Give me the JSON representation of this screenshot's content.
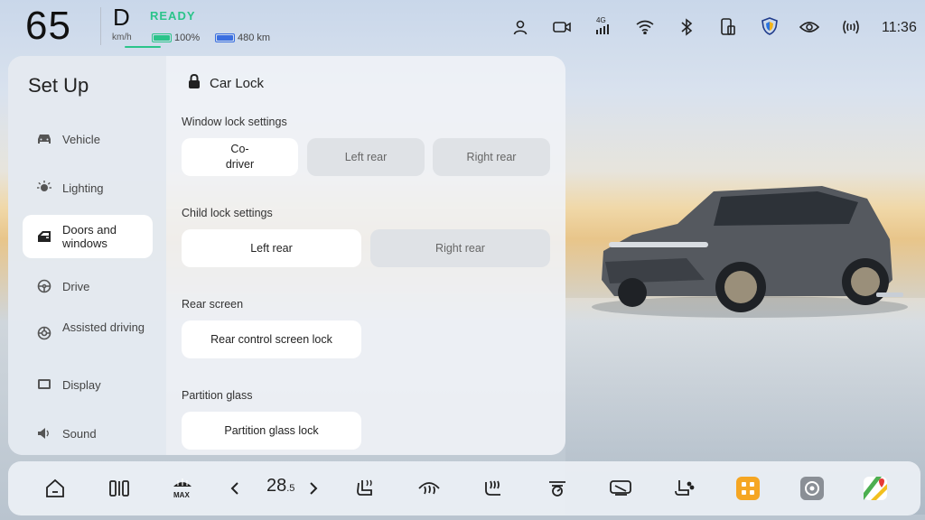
{
  "status_bar": {
    "speed": "65",
    "speed_unit": "km/h",
    "gear": "D",
    "ready": "READY",
    "battery_percent": "100%",
    "range": "480 km",
    "time": "11:36",
    "icons": [
      "person-icon",
      "camera-icon",
      "signal-4g-icon",
      "wifi-icon",
      "bluetooth-icon",
      "phone-device-icon",
      "shield-icon",
      "eye-icon",
      "broadcast-icon"
    ]
  },
  "sidebar": {
    "title": "Set Up",
    "items": [
      {
        "label": "Vehicle",
        "icon": "car-icon"
      },
      {
        "label": "Lighting",
        "icon": "light-icon"
      },
      {
        "label": "Doors and windows",
        "icon": "door-icon",
        "active": true
      },
      {
        "label": "Drive",
        "icon": "steering-icon"
      },
      {
        "label": "Assisted driving",
        "icon": "assist-icon"
      },
      {
        "label": "Display",
        "icon": "display-icon"
      },
      {
        "label": "Sound",
        "icon": "speaker-icon"
      }
    ]
  },
  "content": {
    "title": "Car Lock",
    "window_lock": {
      "label": "Window lock settings",
      "options": [
        "Co-driver",
        "Left rear",
        "Right rear"
      ],
      "selected": [
        "Co-driver"
      ]
    },
    "child_lock": {
      "label": "Child lock settings",
      "options": [
        "Left rear",
        "Right rear"
      ],
      "selected": [
        "Left rear"
      ]
    },
    "rear_screen": {
      "label": "Rear screen",
      "button": "Rear control screen lock"
    },
    "partition_glass": {
      "label": "Partition glass",
      "button": "Partition glass lock"
    }
  },
  "dock": {
    "temperature_main": "28",
    "temperature_decimal": ".5",
    "icons": [
      "home-icon",
      "split-screen-icon",
      "max-defrost-icon",
      "temp-down-icon",
      "temp-up-icon",
      "seat-heat-icon",
      "front-defrost-icon",
      "seat-ventilation-icon",
      "fan-icon",
      "rear-defrost-icon",
      "seat-massage-icon",
      "apps-icon",
      "settings-icon",
      "maps-icon"
    ]
  },
  "colors": {
    "ready": "#2bc48a",
    "battery": "#2bc48a",
    "range": "#3b6fe0",
    "apps_accent": "#f5a623"
  }
}
